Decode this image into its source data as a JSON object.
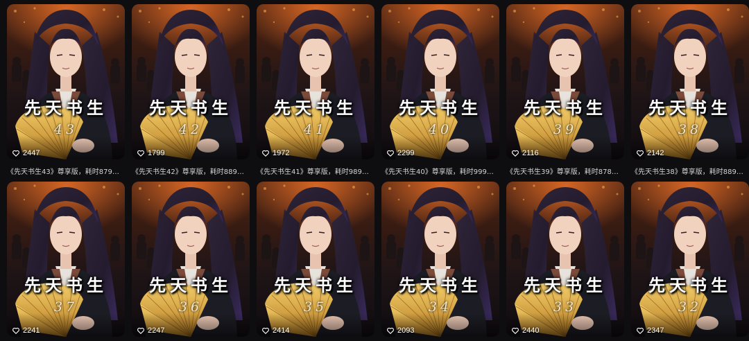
{
  "cover": {
    "title_calligraphy": "先天书生"
  },
  "rows": [
    {
      "items": [
        {
          "episode": "43",
          "likes": "2447",
          "caption": "《先天书生43》尊享版，耗时879小…"
        },
        {
          "episode": "42",
          "likes": "1799",
          "caption": "《先天书生42》尊享版，耗时889小…"
        },
        {
          "episode": "41",
          "likes": "1972",
          "caption": "《先天书生41》尊享版，耗时989小…"
        },
        {
          "episode": "40",
          "likes": "2299",
          "caption": "《先天书生40》尊享版，耗时999小…"
        },
        {
          "episode": "39",
          "likes": "2116",
          "caption": "《先天书生39》尊享版，耗时878小…"
        },
        {
          "episode": "38",
          "likes": "2142",
          "caption": "《先天书生38》尊享版，耗时889小…"
        }
      ]
    },
    {
      "items": [
        {
          "episode": "37",
          "likes": "2241",
          "caption": ""
        },
        {
          "episode": "36",
          "likes": "2247",
          "caption": ""
        },
        {
          "episode": "35",
          "likes": "2414",
          "caption": ""
        },
        {
          "episode": "34",
          "likes": "2093",
          "caption": ""
        },
        {
          "episode": "33",
          "likes": "2440",
          "caption": ""
        },
        {
          "episode": "32",
          "likes": "2347",
          "caption": ""
        }
      ]
    }
  ],
  "icons": {
    "like": "heart-outline-icon"
  },
  "colors": {
    "background": "#0e0e10",
    "caption_text": "#d4d4d8",
    "fan_gold": "#e3b34a",
    "robe": "#1c1c24",
    "hair": "#241c2e"
  }
}
